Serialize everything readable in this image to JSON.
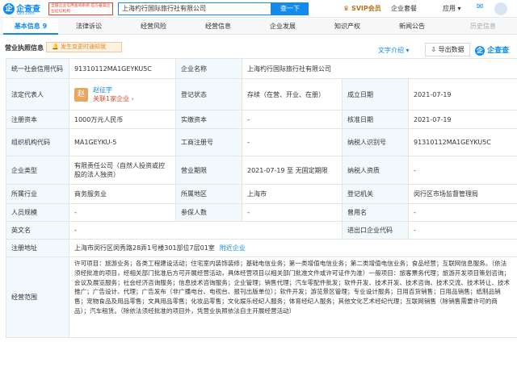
{
  "header": {
    "logo_mark": "企",
    "logo_name": "企查查",
    "logo_domain": "Qcc.com",
    "tagline": "全国企业信用查询系统 官方备案企业征信机构",
    "search_value": "上海杓行国际旅行社有限公司",
    "search_button": "查一下",
    "svip": "SVIP会员",
    "nav": [
      "企业套餐",
      "应用"
    ]
  },
  "tabs": [
    {
      "label": "基本信息 9",
      "state": "active"
    },
    {
      "label": "法律诉讼",
      "state": "normal"
    },
    {
      "label": "经营风险",
      "state": "normal"
    },
    {
      "label": "经营信息",
      "state": "normal"
    },
    {
      "label": "企业发展",
      "state": "normal"
    },
    {
      "label": "知识产权",
      "state": "normal"
    },
    {
      "label": "新闻公告",
      "state": "normal"
    },
    {
      "label": "历史信息",
      "state": "dim"
    }
  ],
  "section": {
    "title": "营业执照信息",
    "notice": "发生变更时通知我",
    "text_translate": "文字介绍",
    "export": "导出数据",
    "qcc_logo": "企查查"
  },
  "info": {
    "credit_code_label": "统一社会信用代码",
    "credit_code": "91310112MA1GEYKU5C",
    "company_name_label": "企业名称",
    "company_name": "上海杓行国际旅行社有限公司",
    "legal_rep_label": "法定代表人",
    "legal_rep_avatar": "赵",
    "legal_rep_name": "赵征宇",
    "legal_rep_link": "关联1家企业",
    "status_label": "登记状态",
    "status": "存续（在营、开业、在册）",
    "founded_label": "成立日期",
    "founded": "2021-07-19",
    "capital_label": "注册资本",
    "capital": "1000万元人民币",
    "paid_capital_label": "实缴资本",
    "paid_capital": "-",
    "approved_label": "核准日期",
    "approved": "2021-07-19",
    "org_code_label": "组织机构代码",
    "org_code": "MA1GEYKU-5",
    "biz_reg_label": "工商注册号",
    "biz_reg": "-",
    "taxpayer_id_label": "纳税人识别号",
    "taxpayer_id": "91310112MA1GEYKU5C",
    "type_label": "企业类型",
    "type": "有限责任公司（自然人投资或控股的法人独资）",
    "term_label": "营业期限",
    "term": "2021-07-19 至 无固定期限",
    "taxpayer_qual_label": "纳税人资质",
    "taxpayer_qual": "-",
    "industry_label": "所属行业",
    "industry": "商务服务业",
    "region_label": "所属地区",
    "region": "上海市",
    "authority_label": "登记机关",
    "authority": "闵行区市场监督管理局",
    "staff_label": "人员规模",
    "staff": "-",
    "insured_label": "参保人数",
    "insured": "-",
    "former_name_label": "曾用名",
    "former_name": "-",
    "en_name_label": "英文名",
    "en_name": "-",
    "import_export_label": "进出口企业代码",
    "import_export": "-",
    "address_label": "注册地址",
    "address": "上海市闵行区闵秀路28弄1号楼301部位7层01室",
    "address_link": "附近企业",
    "scope_label": "经营范围",
    "scope": "许可项目：旅游业务；各类工程建设活动；住宅室内装饰装修；基础电信业务；第一类增值电信业务；第二类增值电信业务；食品经营；互联网信息服务。（依法须经批准的项目，经相关部门批准后方可开展经营活动，具体经营项目以相关部门批准文件或许可证件为准）一般项目：旅客票务代理；旅游开发项目策划咨询；会议及展览服务；社会经济咨询服务；信息技术咨询服务；企业管理；销售代理；汽车零配件批发；软件开发、技术开发、技术咨询、技术交流、技术转让、技术推广；广告设计、代理；广告发布（非广播电台、电视台、报刊出版单位）；软件开发；游览景区管理；专业设计服务；日用百货销售；日用品销售；纸制品销售；宠物食品及用品零售；文具用品零售；化妆品零售；文化娱乐经纪人服务；体育经纪人服务；其他文化艺术经纪代理；互联网销售（除销售需要许可的商品）；汽车租赁。（除依法须经批准的项目外，凭营业执照依法自主开展经营活动）"
  }
}
